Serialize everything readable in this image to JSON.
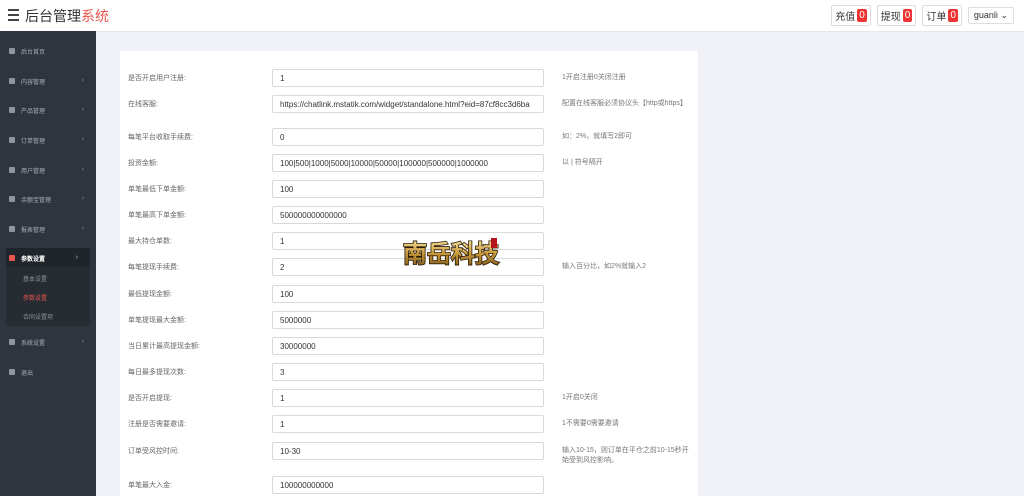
{
  "header": {
    "title_main": "后台管理",
    "title_accent": "系统",
    "recharge_label": "充值",
    "recharge_count": "0",
    "withdraw_label": "提现",
    "withdraw_count": "0",
    "orders_label": "订单",
    "orders_count": "0",
    "username": "guanli"
  },
  "sidebar": {
    "items": [
      {
        "label": "后台首页",
        "icon": "dashboard-icon"
      },
      {
        "label": "内容管理",
        "icon": "content-icon"
      },
      {
        "label": "产品管理",
        "icon": "product-icon"
      },
      {
        "label": "订单管理",
        "icon": "order-icon"
      },
      {
        "label": "用户管理",
        "icon": "user-icon"
      },
      {
        "label": "余额宝管理",
        "icon": "wallet-icon"
      },
      {
        "label": "报表管理",
        "icon": "report-icon"
      },
      {
        "label": "参数设置",
        "icon": "settings-icon"
      },
      {
        "label": "系统设置",
        "icon": "gears-icon"
      },
      {
        "label": "退出",
        "icon": "logout-icon"
      }
    ],
    "submenu": [
      "基本设置",
      "参数设置",
      "合同设置项"
    ]
  },
  "form": {
    "rows": [
      {
        "label": "是否开启用户注册:",
        "value": "1",
        "hint": "1开启注册0关闭注册"
      },
      {
        "label": "在线客服:",
        "value": "https://chatlink.mstatik.com/widget/standalone.html?eid=87cf8cc3d6ba",
        "hint": "配置在线客服必须协议头【http或https】"
      },
      {
        "label": "每笔平台收取手续费:",
        "value": "0",
        "hint": "如：2%，就填写2即可"
      },
      {
        "label": "投资金额:",
        "value": "100|500|1000|5000|10000|50000|100000|500000|1000000",
        "hint": "以 | 符号隔开"
      },
      {
        "label": "单笔最低下单金额:",
        "value": "100",
        "hint": ""
      },
      {
        "label": "单笔最高下单金额:",
        "value": "500000000000000",
        "hint": ""
      },
      {
        "label": "最大持仓单数:",
        "value": "1",
        "hint": ""
      },
      {
        "label": "每笔提现手续费:",
        "value": "2",
        "hint": "输入百分比，如2%就输入2"
      },
      {
        "label": "最低提现金额:",
        "value": "100",
        "hint": ""
      },
      {
        "label": "单笔提现最大金额:",
        "value": "5000000",
        "hint": ""
      },
      {
        "label": "当日累计最高提现金额:",
        "value": "30000000",
        "hint": ""
      },
      {
        "label": "每日最多提现次数:",
        "value": "3",
        "hint": ""
      },
      {
        "label": "是否开启提现:",
        "value": "1",
        "hint": "1开启0关闭"
      },
      {
        "label": "注册是否需要邀请:",
        "value": "1",
        "hint": "1不需要0需要邀请"
      },
      {
        "label": "订单受风控时间:",
        "value": "10-30",
        "hint": "输入10-15，则订单在平仓之前10-15秒开始受到风控影响。"
      },
      {
        "label": "单笔最大入金:",
        "value": "100000000000",
        "hint": ""
      }
    ]
  },
  "watermark": {
    "text": "南岳科技"
  },
  "colors": {
    "accent": "#e8554e",
    "sidebar": "#2f353f",
    "badge": "#e33333"
  }
}
